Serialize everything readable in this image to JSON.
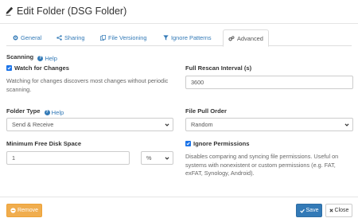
{
  "dialog": {
    "title": "Edit Folder (DSG Folder)"
  },
  "tabs": [
    {
      "label": "General",
      "icon": "gear-icon"
    },
    {
      "label": "Sharing",
      "icon": "share-icon"
    },
    {
      "label": "File Versioning",
      "icon": "copy-icon"
    },
    {
      "label": "Ignore Patterns",
      "icon": "filter-icon"
    },
    {
      "label": "Advanced",
      "icon": "gears-icon",
      "active": true
    }
  ],
  "scanning": {
    "label": "Scanning",
    "help": "Help",
    "watch_label": "Watch for Changes",
    "watch_checked": true,
    "watch_desc": "Watching for changes discovers most changes without periodic scanning.",
    "rescan_label": "Full Rescan Interval (s)",
    "rescan_value": "3600"
  },
  "folder_type": {
    "label": "Folder Type",
    "help": "Help",
    "value": "Send & Receive"
  },
  "file_pull_order": {
    "label": "File Pull Order",
    "value": "Random"
  },
  "min_disk": {
    "label": "Minimum Free Disk Space",
    "value": "1",
    "unit": "%"
  },
  "ignore_permissions": {
    "label": "Ignore Permissions",
    "checked": true,
    "desc": "Disables comparing and syncing file permissions. Useful on systems with nonexistent or custom permissions (e.g. FAT, exFAT, Synology, Android)."
  },
  "footer": {
    "remove_label": "Remove",
    "save_label": "Save",
    "close_label": "Close"
  },
  "colors": {
    "link": "#337ab7",
    "warning": "#f0ad4e",
    "primary": "#337ab7",
    "checkbox": "#1a73e8"
  }
}
